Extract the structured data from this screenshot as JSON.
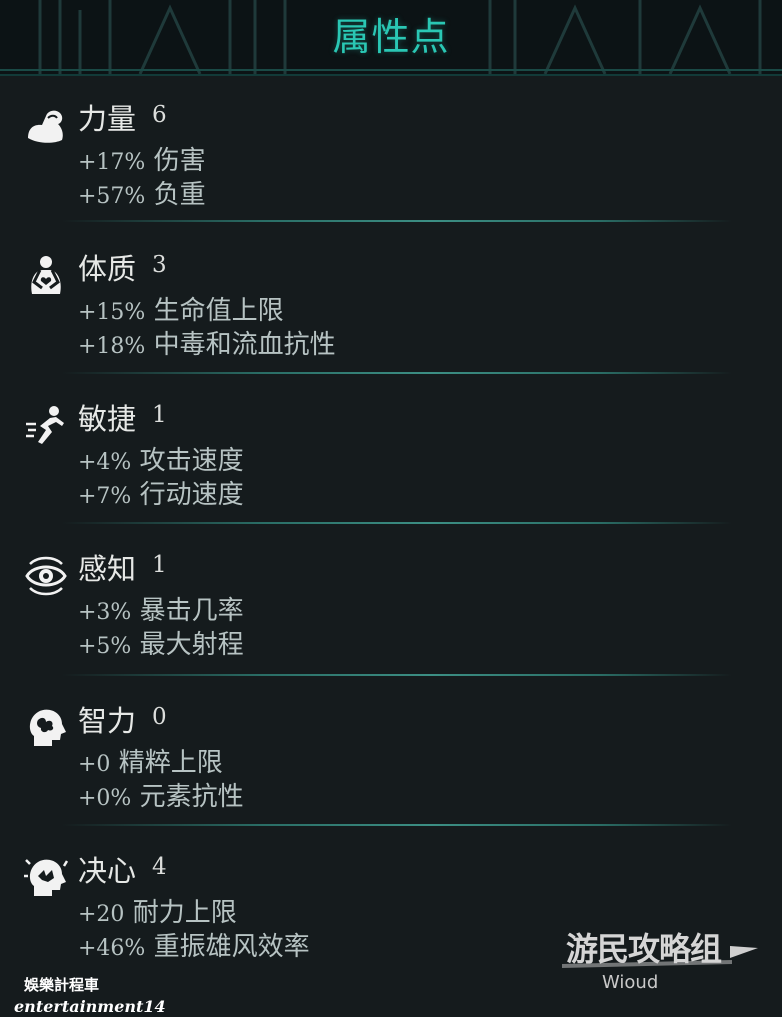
{
  "panel": {
    "title": "属性点"
  },
  "attributes": [
    {
      "icon": "strength-icon",
      "name": "力量",
      "level": "6",
      "bonuses": [
        {
          "pct": "+17%",
          "label": "伤害"
        },
        {
          "pct": "+57%",
          "label": "负重"
        }
      ]
    },
    {
      "icon": "constitution-icon",
      "name": "体质",
      "level": "3",
      "bonuses": [
        {
          "pct": "+15%",
          "label": "生命值上限"
        },
        {
          "pct": "+18%",
          "label": "中毒和流血抗性"
        }
      ]
    },
    {
      "icon": "agility-icon",
      "name": "敏捷",
      "level": "1",
      "bonuses": [
        {
          "pct": "+4%",
          "label": "攻击速度"
        },
        {
          "pct": "+7%",
          "label": "行动速度"
        }
      ]
    },
    {
      "icon": "perception-icon",
      "name": "感知",
      "level": "1",
      "bonuses": [
        {
          "pct": "+3%",
          "label": "暴击几率"
        },
        {
          "pct": "+5%",
          "label": "最大射程"
        }
      ]
    },
    {
      "icon": "intelligence-icon",
      "name": "智力",
      "level": "0",
      "bonuses": [
        {
          "pct": "+0",
          "label": "精粹上限"
        },
        {
          "pct": "+0%",
          "label": "元素抗性"
        }
      ]
    },
    {
      "icon": "willpower-icon",
      "name": "决心",
      "level": "4",
      "bonuses": [
        {
          "pct": "+20",
          "label": "耐力上限"
        },
        {
          "pct": "+46%",
          "label": "重振雄风效率"
        }
      ]
    }
  ],
  "watermark": {
    "brand": "游民攻略组",
    "sub": "Wioud"
  },
  "credit": {
    "line1": "娛樂計程車",
    "line2": "entertainment14"
  },
  "colors": {
    "background": "#151b1d",
    "title": "#2ac7b4",
    "divider": "#3c8f84",
    "bonus_text": "#b7c3c3"
  }
}
